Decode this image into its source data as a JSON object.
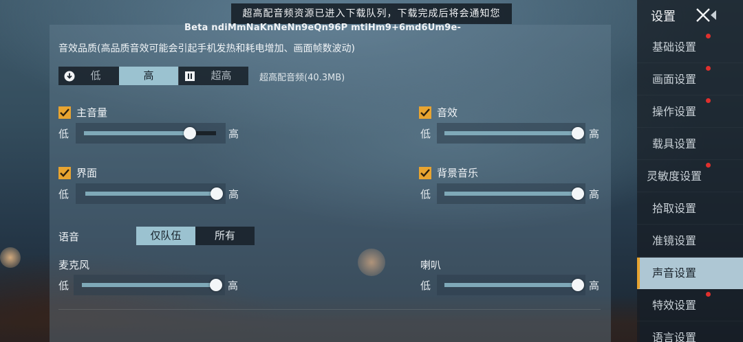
{
  "notice": "超高配音频资源已进入下载队列，下载完成后将会通知您",
  "beta_text": "Beta ndiMmNaKnNeNn9eQn96P mtiHm9+6md6Um9e-",
  "quality": {
    "description": "音效品质(高品质音效可能会引起手机发热和耗电增加、画面帧数波动)",
    "options": [
      {
        "label": "低",
        "icon": "download-icon",
        "selected": false
      },
      {
        "label": "高",
        "selected": true
      },
      {
        "label": "超高",
        "icon": "pause-icon",
        "selected": false
      }
    ],
    "note": "超高配音频(40.3MB)"
  },
  "sliders": {
    "low_label": "低",
    "high_label": "高",
    "master": {
      "label": "主音量",
      "checked": true,
      "value": 0.8
    },
    "sfx": {
      "label": "音效",
      "checked": true,
      "value": 1.0
    },
    "ui": {
      "label": "界面",
      "checked": true,
      "value": 1.0
    },
    "music": {
      "label": "背景音乐",
      "checked": true,
      "value": 1.0
    },
    "mic": {
      "label": "麦克风",
      "value": 1.0
    },
    "speaker": {
      "label": "喇叭",
      "value": 1.0
    }
  },
  "voice": {
    "label": "语音",
    "options": [
      {
        "label": "仅队伍",
        "selected": true
      },
      {
        "label": "所有",
        "selected": false
      }
    ]
  },
  "sidebar": {
    "title": "设置",
    "items": [
      {
        "label": "基础设置",
        "badge": true
      },
      {
        "label": "画面设置",
        "badge": true
      },
      {
        "label": "操作设置",
        "badge": true
      },
      {
        "label": "载具设置",
        "badge": false
      },
      {
        "label": "灵敏度设置",
        "badge": true
      },
      {
        "label": "拾取设置",
        "badge": false
      },
      {
        "label": "准镜设置",
        "badge": false
      },
      {
        "label": "声音设置",
        "badge": false,
        "active": true
      },
      {
        "label": "特效设置",
        "badge": true
      },
      {
        "label": "语言设置",
        "badge": false
      }
    ]
  },
  "colors": {
    "accent": "#e8a430",
    "selected": "#9bc2d0",
    "badge": "#e0302d"
  }
}
